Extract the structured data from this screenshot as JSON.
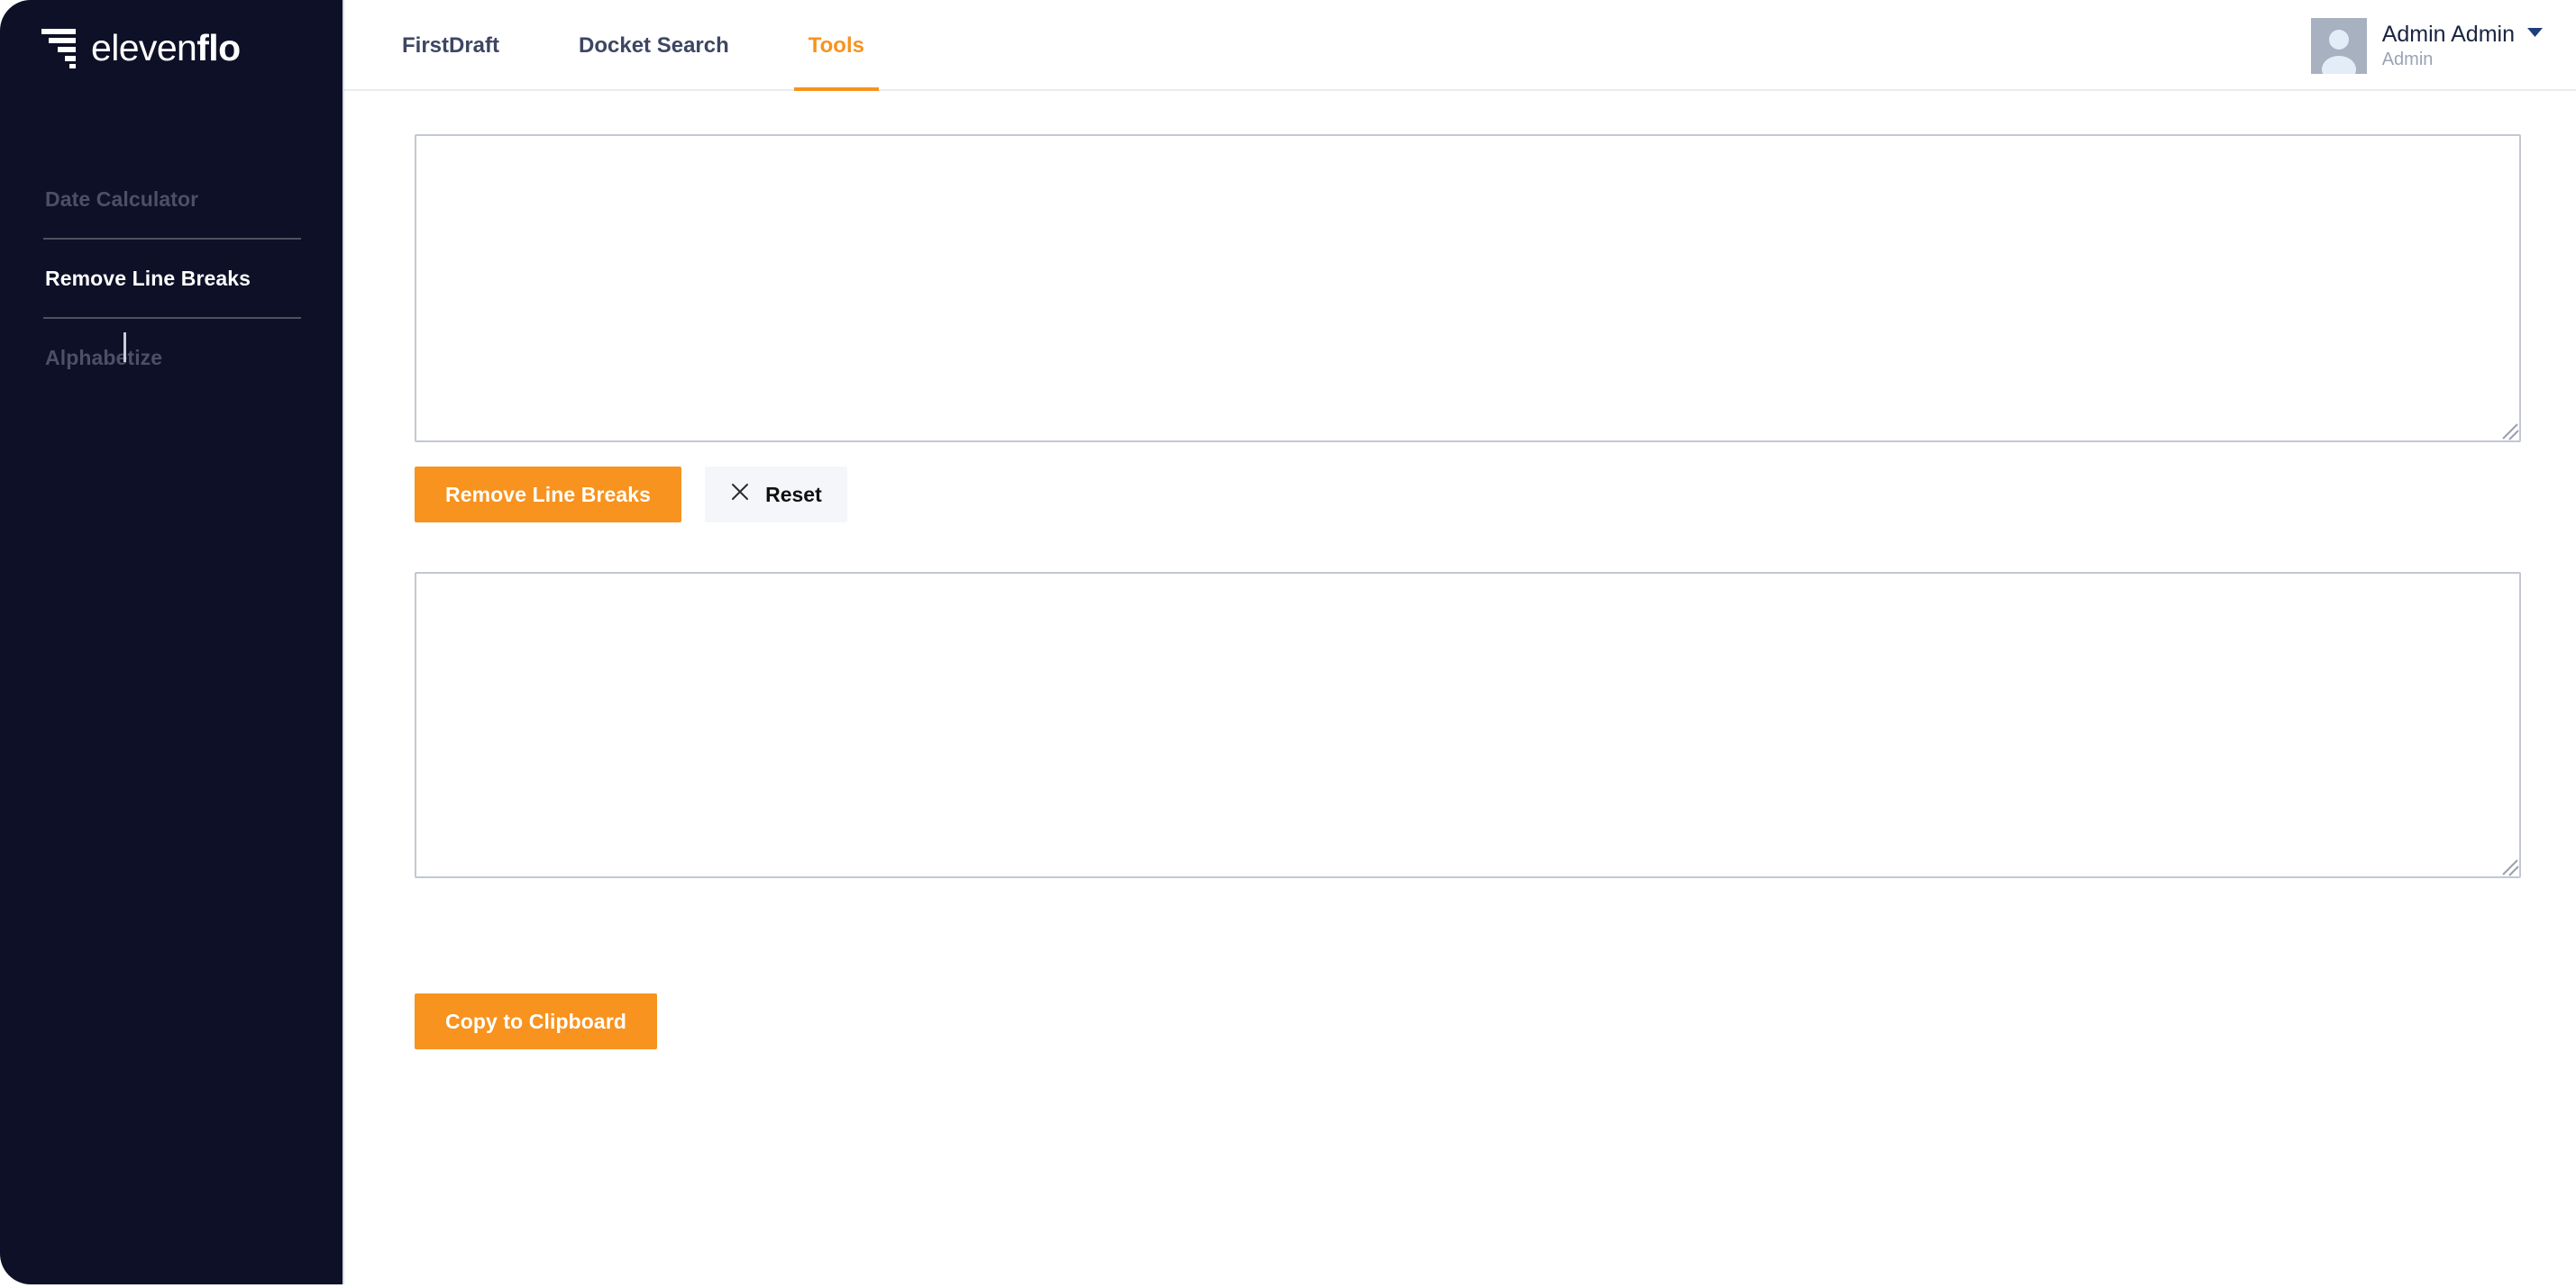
{
  "brand": {
    "name_light": "eleven",
    "name_bold": "flo",
    "icon": "funnel-logo-icon",
    "background_color": "#0d1026",
    "accent_color": "#f7931e"
  },
  "sidebar": {
    "items": [
      {
        "label": "Date Calculator",
        "active": false
      },
      {
        "label": "Remove Line Breaks",
        "active": true
      },
      {
        "label": "Alphabetize",
        "active": false
      }
    ]
  },
  "header": {
    "tabs": [
      {
        "label": "FirstDraft",
        "active": false
      },
      {
        "label": "Docket Search",
        "active": false
      },
      {
        "label": "Tools",
        "active": true
      }
    ],
    "user": {
      "name": "Admin Admin",
      "role": "Admin",
      "avatar_icon": "user-avatar-icon",
      "caret_icon": "chevron-down-icon"
    }
  },
  "main": {
    "input_textarea": {
      "value": "",
      "placeholder": ""
    },
    "output_textarea": {
      "value": "",
      "placeholder": ""
    },
    "remove_line_breaks_label": "Remove Line Breaks",
    "reset_label": "Reset",
    "reset_icon": "close-x-icon",
    "copy_label": "Copy to Clipboard"
  }
}
